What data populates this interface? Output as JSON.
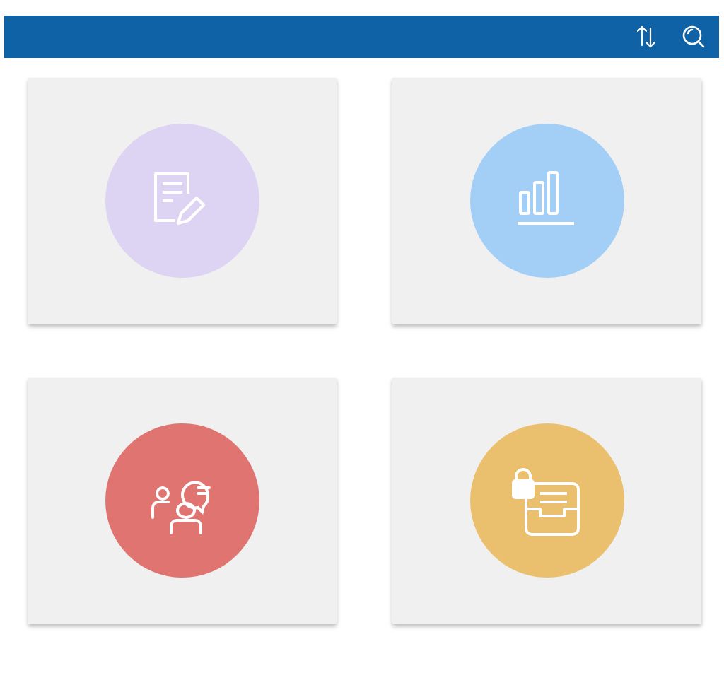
{
  "toolbar": {
    "actions": [
      {
        "kind": "sort"
      },
      {
        "kind": "search"
      }
    ]
  },
  "cards": [
    {
      "kind": "document",
      "color": "#ddd3f3"
    },
    {
      "kind": "chart",
      "color": "#a3cff7"
    },
    {
      "kind": "chat",
      "color": "#e07470"
    },
    {
      "kind": "inbox",
      "color": "#eabf6e"
    }
  ]
}
